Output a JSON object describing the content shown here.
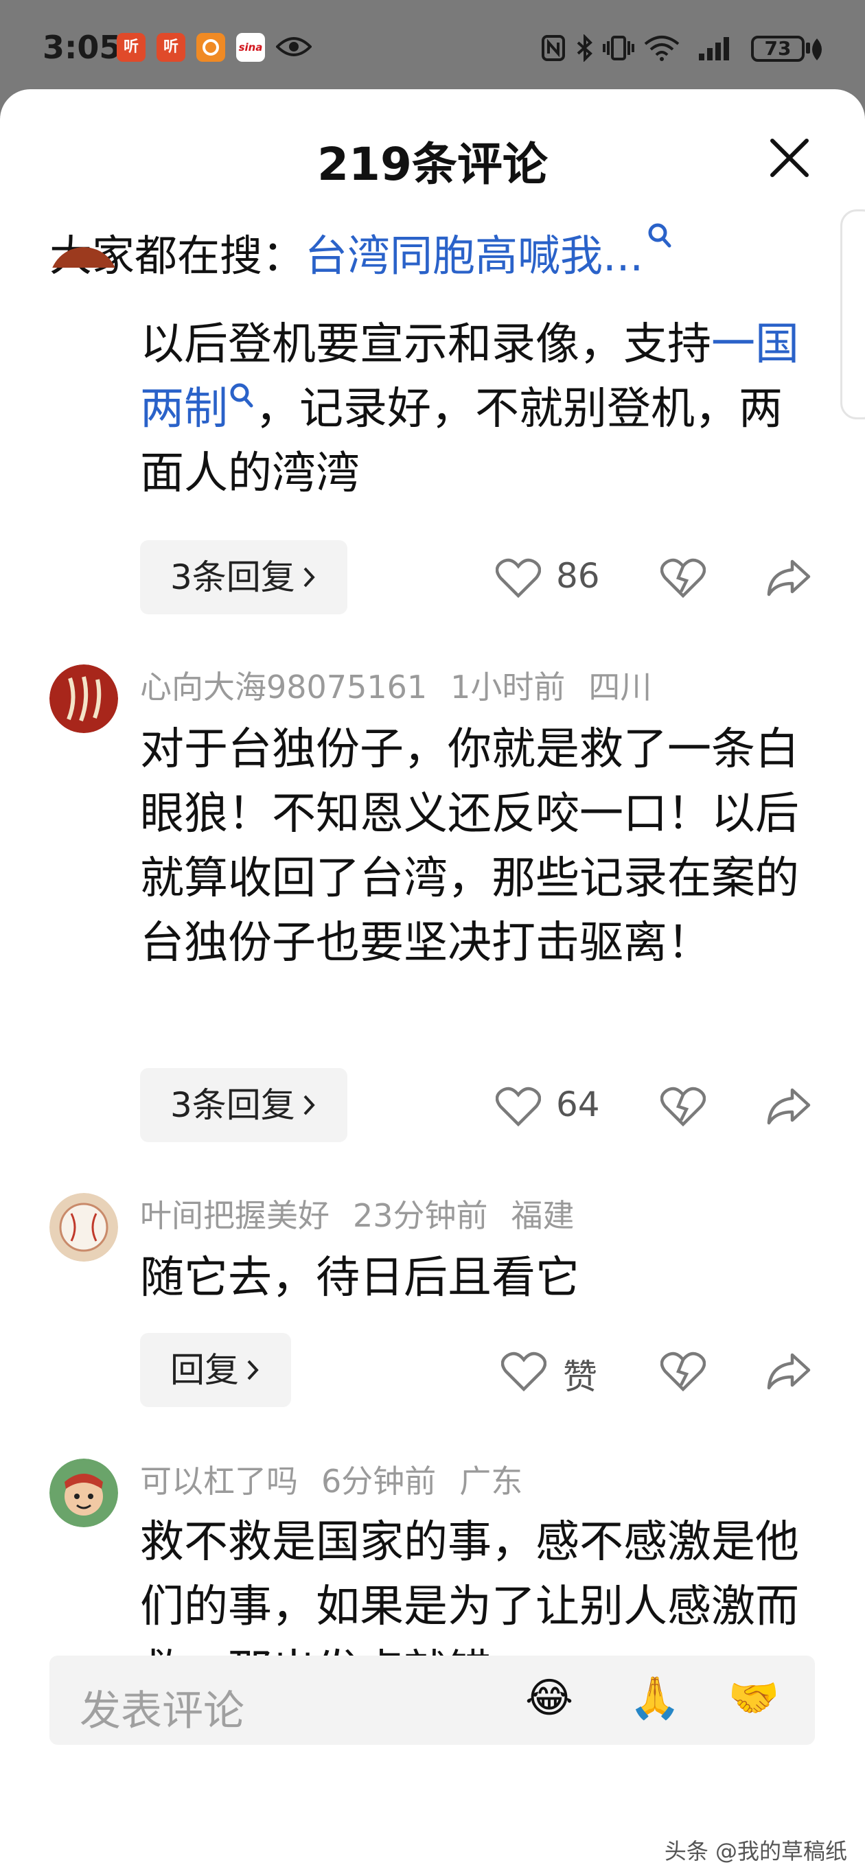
{
  "status_bar": {
    "time": "3:05",
    "app_icons": [
      "听",
      "听",
      "",
      "sina"
    ],
    "battery": "73"
  },
  "sheet": {
    "title": "219条评论",
    "search_prefix": "大家都在搜：",
    "search_term": "台湾同胞高喊我..."
  },
  "comments": [
    {
      "text_parts": [
        "以后登机要宣示和录像，支持",
        "一国两制",
        "，记录好，不就别登机，两面人的湾湾"
      ],
      "reply_label": "3条回复",
      "likes": "86"
    },
    {
      "user": "心向大海98075161",
      "time": "1小时前",
      "location": "四川",
      "text": "对于台独份子，你就是救了一条白眼狼！不知恩义还反咬一口！以后就算收回了台湾，那些记录在案的台独份子也要坚决打击驱离！",
      "reply_label": "3条回复",
      "likes": "64"
    },
    {
      "user": "叶间把握美好",
      "time": "23分钟前",
      "location": "福建",
      "text": "随它去，待日后且看它",
      "reply_label": "回复",
      "likes": "赞"
    },
    {
      "user": "可以杠了吗",
      "time": "6分钟前",
      "location": "广东",
      "text": "救不救是国家的事，感不感激是他们的事，如果是为了让别人感激而救，那出发点就错"
    }
  ],
  "bottom": {
    "placeholder": "发表评论",
    "emojis": [
      "😂",
      "🙏",
      "🤝"
    ]
  },
  "watermark": "头条 @我的草稿纸",
  "colors": {
    "link": "#2a62c9",
    "meta_gray": "#9a9a9a",
    "icon_gray": "#7a7a7a"
  }
}
